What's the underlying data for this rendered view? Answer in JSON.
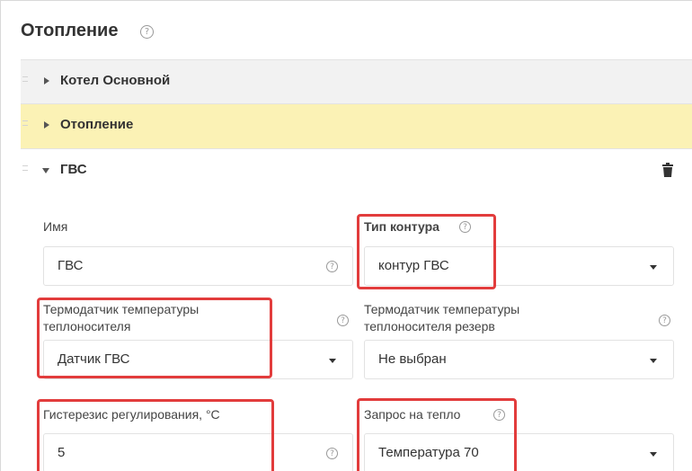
{
  "section": {
    "title": "Отопление",
    "help_icon": "question-circle-icon"
  },
  "panels": [
    {
      "label": "Котел Основной",
      "expanded": false,
      "background": "#f2f2f2"
    },
    {
      "label": "Отопление",
      "expanded": false,
      "background": "#fbf2b5"
    },
    {
      "label": "ГВС",
      "expanded": true,
      "background": "#ffffff"
    }
  ],
  "form": {
    "name": {
      "label": "Имя",
      "value": "ГВС"
    },
    "circuit_type": {
      "label": "Тип контура",
      "value": "контур ГВС"
    },
    "sensor": {
      "label_line1": "Термодатчик температуры",
      "label_line2": "теплоносителя",
      "value": "Датчик ГВС"
    },
    "sensor_reserve": {
      "label_line1": "Термодатчик температуры",
      "label_line2": "теплоносителя резерв",
      "value": "Не выбран"
    },
    "hysteresis": {
      "label": "Гистерезис регулирования, °C",
      "value": "5"
    },
    "heat_request": {
      "label": "Запрос на тепло",
      "value": "Температура 70"
    }
  },
  "colors": {
    "highlight": "#e23c3c",
    "accent_panel": "#fbf2b5"
  }
}
